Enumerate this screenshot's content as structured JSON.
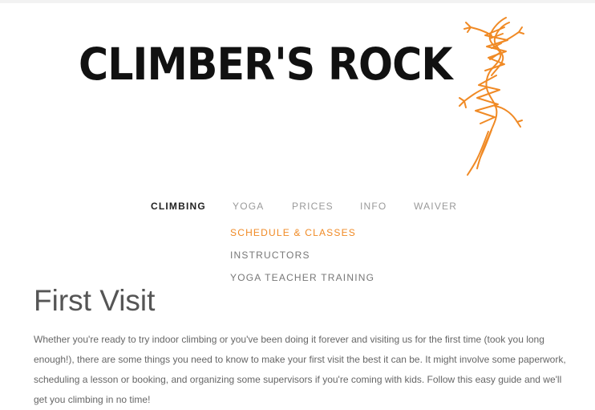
{
  "brand": {
    "name": "CLIMBER'S ROCK",
    "logo_icon": "orange-lizard-icon",
    "accent_color": "#f08a25"
  },
  "nav": {
    "items": [
      {
        "label": "CLIMBING"
      },
      {
        "label": "YOGA"
      },
      {
        "label": "PRICES"
      },
      {
        "label": "INFO"
      },
      {
        "label": "WAIVER"
      }
    ],
    "active": "CLIMBING",
    "submenu": [
      {
        "label": "SCHEDULE & CLASSES"
      },
      {
        "label": "INSTRUCTORS"
      },
      {
        "label": "YOGA TEACHER TRAINING"
      }
    ]
  },
  "main": {
    "title": "First Visit",
    "intro": "Whether you're ready to try indoor climbing or you've been doing it forever and visiting us for the first time (took you long enough!), there are some things you need to know to make your first visit the best it can be. It might involve some paperwork, scheduling a lesson or booking, and organizing some supervisors if you're coming with kids. Follow this easy guide and we'll get you climbing in no time!"
  }
}
